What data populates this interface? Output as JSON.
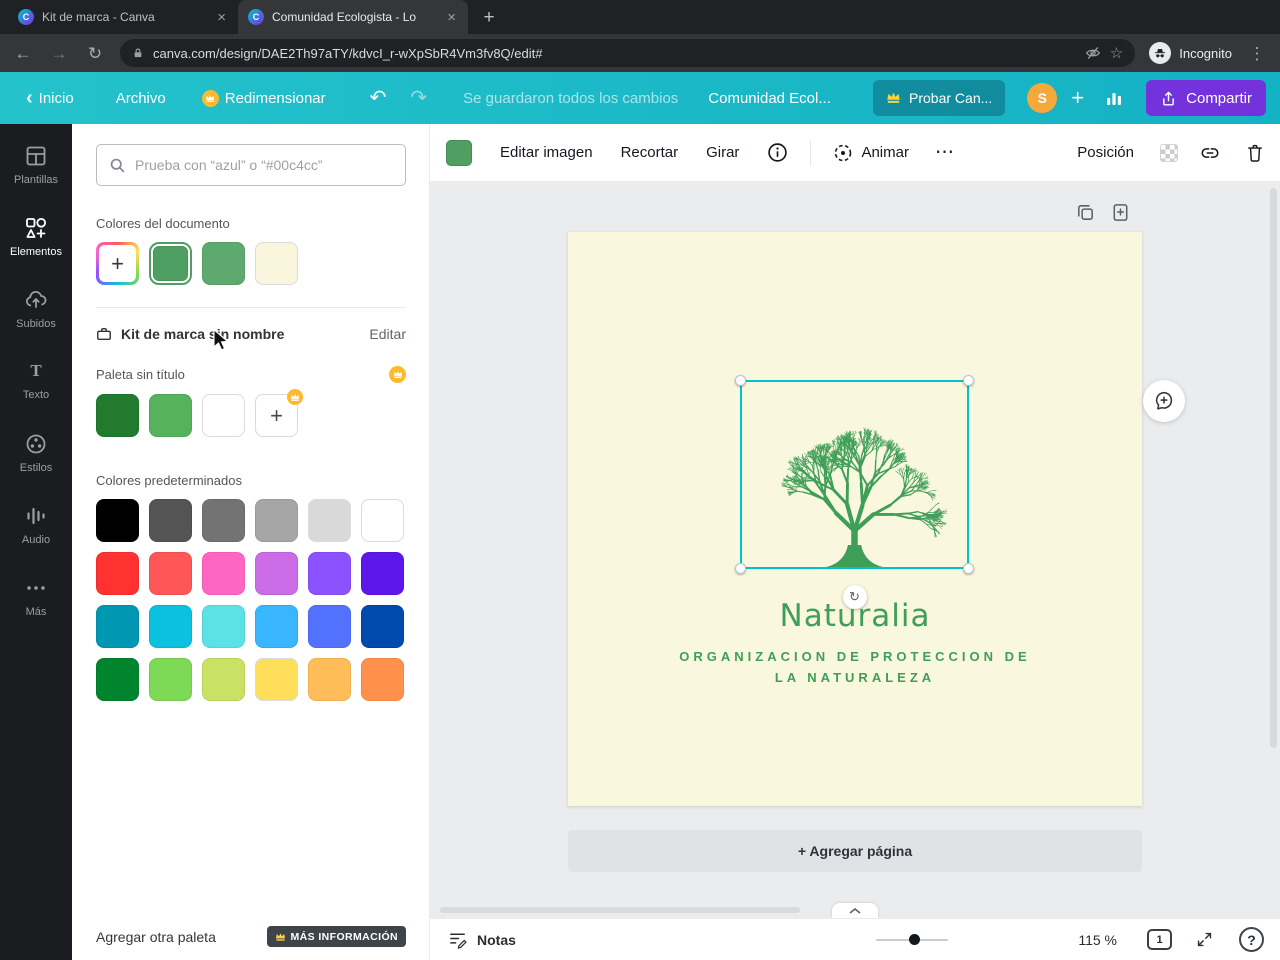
{
  "icons": {
    "plus": "+",
    "close": "×",
    "back": "←",
    "forward": "→",
    "reload": "↻",
    "star": "☆",
    "menu": "⋮",
    "undo": "↶",
    "redo": "↷",
    "chevron_left": "‹",
    "more": "⋯",
    "rotate": "↻",
    "favicon_letter": "C"
  },
  "browser": {
    "tabs": [
      {
        "title": "Kit de marca - Canva"
      },
      {
        "title": "Comunidad Ecologista - Lo"
      }
    ],
    "url": "canva.com/design/DAE2Th97aTY/kdvcI_r-wXpSbR4Vm3fv8Q/edit#",
    "incognito": "Incognito"
  },
  "header": {
    "home": "Inicio",
    "file": "Archivo",
    "resize": "Redimensionar",
    "saved": "Se guardaron todos los cambios",
    "doc_title": "Comunidad Ecol...",
    "try_pro": "Probar Can...",
    "avatar": "S",
    "share": "Compartir"
  },
  "rail": {
    "items": [
      {
        "label": "Plantillas"
      },
      {
        "label": "Elementos"
      },
      {
        "label": "Subidos"
      },
      {
        "label": "Texto"
      },
      {
        "label": "Estilos"
      },
      {
        "label": "Audio"
      },
      {
        "label": "Más"
      }
    ]
  },
  "panel": {
    "search_placeholder": "Prueba con “azul” o “#00c4cc”",
    "doc_colors_title": "Colores del documento",
    "doc_color_selected": "#4f9f62",
    "doc_color_2": "#5da96e",
    "doc_color_3": "#faf6dd",
    "brand_kit_title": "Kit de marca sin nombre",
    "edit_link": "Editar",
    "palette_title": "Paleta sin título",
    "palette_color_1": "#217a2d",
    "palette_color_2": "#57b25e",
    "palette_color_3": "#ffffff",
    "default_colors_title": "Colores predeterminados",
    "default_colors": [
      "#000000",
      "#545454",
      "#737373",
      "#a6a6a6",
      "#d9d9d9",
      "#ffffff",
      "#ff3131",
      "#ff5757",
      "#ff66c4",
      "#cb6ce6",
      "#8c52ff",
      "#5e17eb",
      "#0097b2",
      "#0cc0df",
      "#5ce1e6",
      "#38b6ff",
      "#5271ff",
      "#004aad",
      "#00852e",
      "#7ed957",
      "#c9e265",
      "#ffde59",
      "#ffbd59",
      "#ff914d"
    ],
    "add_palette": "Agregar otra paleta",
    "more_info": "MÁS INFORMACIÓN"
  },
  "toolbar": {
    "swatch_color": "#4f9f62",
    "edit_image": "Editar imagen",
    "crop": "Recortar",
    "rotate": "Girar",
    "animate": "Animar",
    "position": "Posición"
  },
  "canvas": {
    "page_color": "#faf7df",
    "tree_color": "#3f9e58",
    "selection_color": "#00c4cc",
    "text_color": "#3f9e58",
    "logo_title": "Naturalia",
    "subtitle_line1": "ORGANIZACION DE PROTECCION DE",
    "subtitle_line2": "LA NATURALEZA",
    "add_page": "+ Agregar página"
  },
  "statusbar": {
    "notes": "Notas",
    "zoom": "115 %",
    "page": "1"
  }
}
